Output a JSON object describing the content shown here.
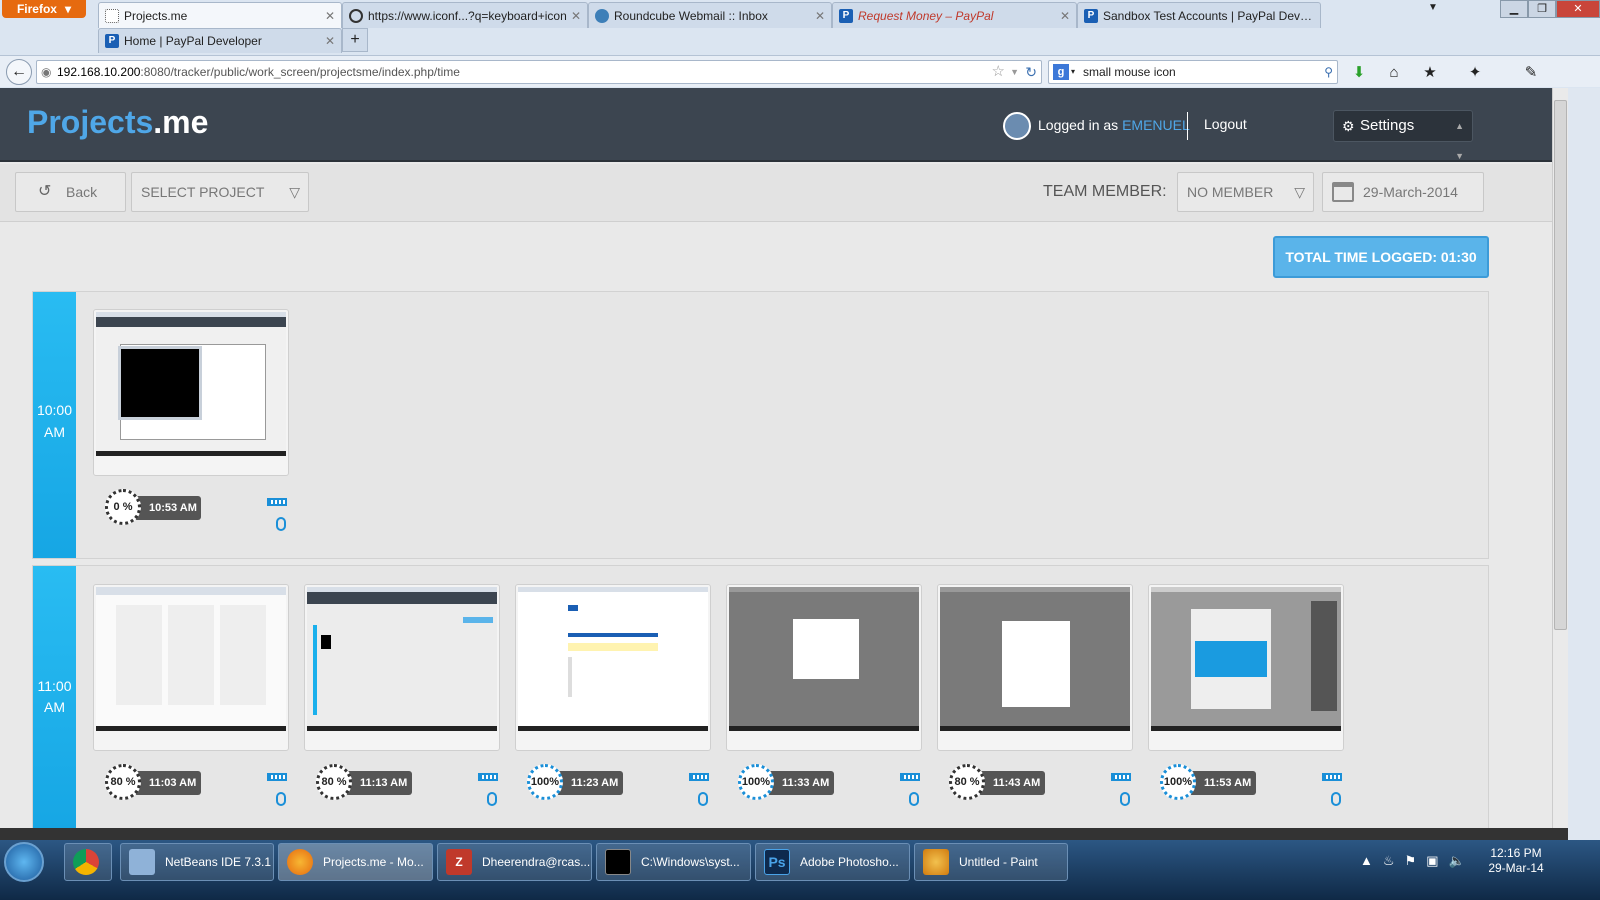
{
  "browser": {
    "menu_button": "Firefox",
    "tabs_row1": [
      {
        "title": "Projects.me",
        "active": true,
        "icon": "blank-page-icon"
      },
      {
        "title": "https://www.iconf...?q=keyboard+icon",
        "active": false,
        "icon": "eye-icon"
      },
      {
        "title": "Roundcube Webmail :: Inbox",
        "active": false,
        "icon": "roundcube-icon"
      },
      {
        "title": "Request Money – PayPal",
        "active": false,
        "icon": "paypal-icon"
      },
      {
        "title": "Sandbox Test Accounts | PayPal Deve...",
        "active": false,
        "icon": "paypal-icon"
      }
    ],
    "tabs_row2": [
      {
        "title": "Home | PayPal Developer",
        "active": false,
        "icon": "paypal-icon"
      }
    ],
    "url_host": "192.168.10.200",
    "url_rest": ":8080/tracker/public/work_screen/projectsme/index.php/time",
    "search_value": "small mouse icon"
  },
  "header": {
    "logo_a": "Projects",
    "logo_b": ".me",
    "logged_prefix": "Logged in as",
    "username": "EMENUEL",
    "logout": "Logout",
    "settings": "Settings"
  },
  "toolbar": {
    "back": "Back",
    "select_project": "SELECT PROJECT",
    "team_member_label": "TEAM MEMBER:",
    "member_value": "NO MEMBER",
    "date_value": "29-March-2014"
  },
  "total_logged": "TOTAL TIME LOGGED: 01:30",
  "hours": [
    {
      "hour": "10:00",
      "ampm": "AM",
      "entries": [
        {
          "percent": "0 %",
          "time": "10:53 AM"
        }
      ]
    },
    {
      "hour": "11:00",
      "ampm": "AM",
      "entries": [
        {
          "percent": "80 %",
          "time": "11:03 AM"
        },
        {
          "percent": "80 %",
          "time": "11:13 AM"
        },
        {
          "percent": "100%",
          "time": "11:23 AM"
        },
        {
          "percent": "100%",
          "time": "11:33 AM"
        },
        {
          "percent": "80 %",
          "time": "11:43 AM"
        },
        {
          "percent": "100%",
          "time": "11:53 AM"
        }
      ]
    }
  ],
  "taskbar": {
    "items": [
      {
        "label": "",
        "icon": "chrome-icon"
      },
      {
        "label": "NetBeans IDE 7.3.1",
        "icon": "netbeans-icon"
      },
      {
        "label": "Projects.me - Mo...",
        "icon": "firefox-icon"
      },
      {
        "label": "Dheerendra@rcas...",
        "icon": "filezilla-icon"
      },
      {
        "label": "C:\\Windows\\syst...",
        "icon": "cmd-icon"
      },
      {
        "label": "Adobe Photosho...",
        "icon": "photoshop-icon"
      },
      {
        "label": "Untitled - Paint",
        "icon": "paint-icon"
      }
    ],
    "time": "12:16 PM",
    "date": "29-Mar-14"
  }
}
